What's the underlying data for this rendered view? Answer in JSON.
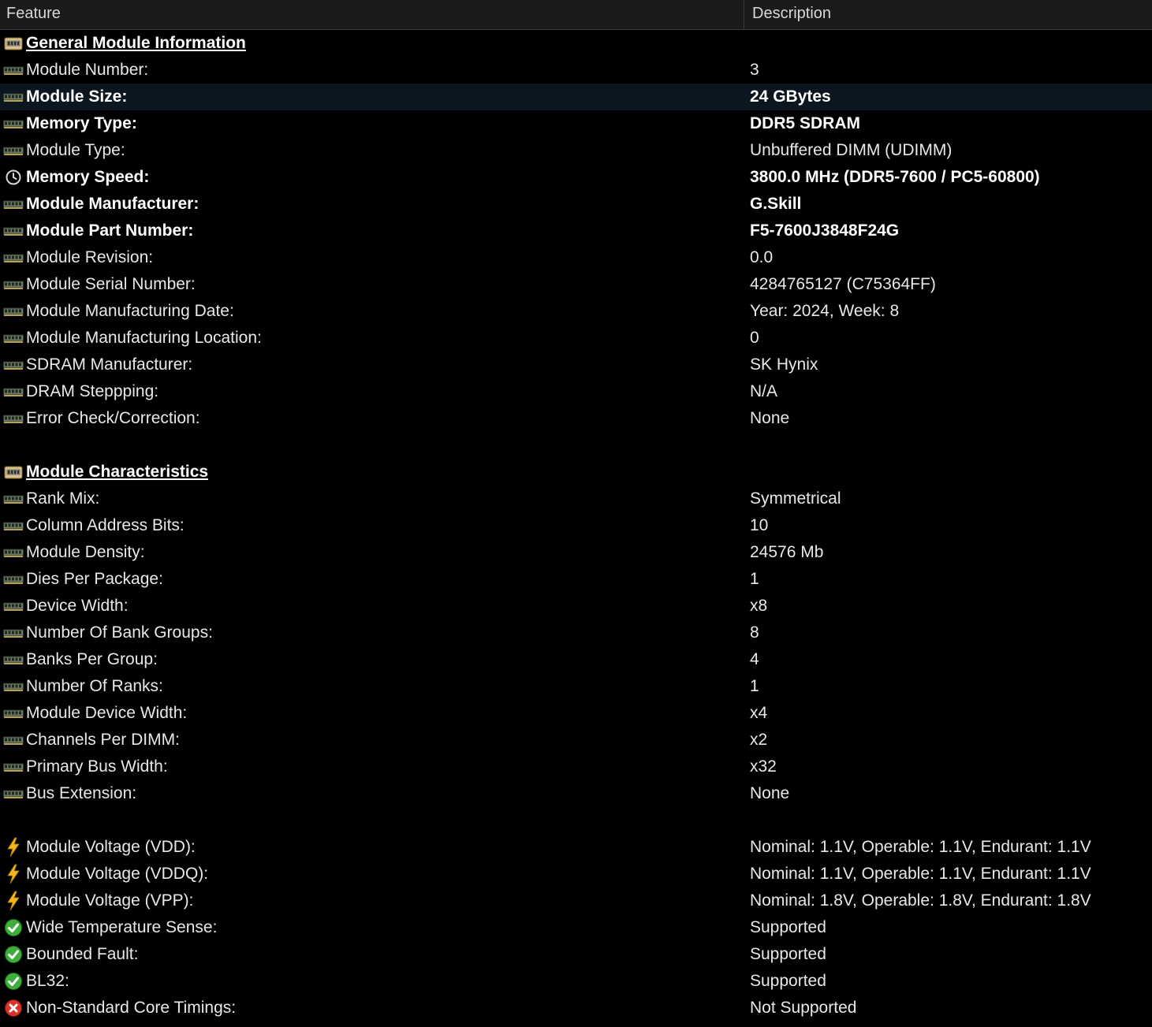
{
  "columns": {
    "feature": "Feature",
    "description": "Description"
  },
  "rows": [
    {
      "type": "section",
      "icon": "module-folder-icon",
      "feature": "General Module Information",
      "desc": ""
    },
    {
      "type": "item",
      "icon": "ram-icon",
      "feature": "Module Number:",
      "desc": "3"
    },
    {
      "type": "item",
      "icon": "ram-icon",
      "feature": "Module Size:",
      "desc": "24 GBytes",
      "bold": true,
      "highlight": true
    },
    {
      "type": "item",
      "icon": "ram-icon",
      "feature": "Memory Type:",
      "desc": "DDR5 SDRAM",
      "bold": true
    },
    {
      "type": "item",
      "icon": "ram-icon",
      "feature": "Module Type:",
      "desc": "Unbuffered DIMM (UDIMM)"
    },
    {
      "type": "item",
      "icon": "clock-icon",
      "feature": "Memory Speed:",
      "desc": "3800.0 MHz (DDR5-7600 / PC5-60800)",
      "bold": true
    },
    {
      "type": "item",
      "icon": "ram-icon",
      "feature": "Module Manufacturer:",
      "desc": "G.Skill",
      "bold": true
    },
    {
      "type": "item",
      "icon": "ram-icon",
      "feature": "Module Part Number:",
      "desc": "F5-7600J3848F24G",
      "bold": true
    },
    {
      "type": "item",
      "icon": "ram-icon",
      "feature": "Module Revision:",
      "desc": "0.0"
    },
    {
      "type": "item",
      "icon": "ram-icon",
      "feature": "Module Serial Number:",
      "desc": "4284765127 (C75364FF)"
    },
    {
      "type": "item",
      "icon": "ram-icon",
      "feature": "Module Manufacturing Date:",
      "desc": "Year: 2024, Week: 8"
    },
    {
      "type": "item",
      "icon": "ram-icon",
      "feature": "Module Manufacturing Location:",
      "desc": "0"
    },
    {
      "type": "item",
      "icon": "ram-icon",
      "feature": "SDRAM Manufacturer:",
      "desc": "SK Hynix"
    },
    {
      "type": "item",
      "icon": "ram-icon",
      "feature": "DRAM Steppping:",
      "desc": "N/A"
    },
    {
      "type": "item",
      "icon": "ram-icon",
      "feature": "Error Check/Correction:",
      "desc": "None"
    },
    {
      "type": "blank"
    },
    {
      "type": "section",
      "icon": "module-folder-icon",
      "feature": "Module Characteristics",
      "desc": ""
    },
    {
      "type": "item",
      "icon": "ram-icon",
      "feature": "Rank Mix:",
      "desc": "Symmetrical"
    },
    {
      "type": "item",
      "icon": "ram-icon",
      "feature": "Column Address Bits:",
      "desc": "10"
    },
    {
      "type": "item",
      "icon": "ram-icon",
      "feature": "Module Density:",
      "desc": "24576 Mb"
    },
    {
      "type": "item",
      "icon": "ram-icon",
      "feature": "Dies Per Package:",
      "desc": "1"
    },
    {
      "type": "item",
      "icon": "ram-icon",
      "feature": "Device Width:",
      "desc": "x8"
    },
    {
      "type": "item",
      "icon": "ram-icon",
      "feature": "Number Of Bank Groups:",
      "desc": "8"
    },
    {
      "type": "item",
      "icon": "ram-icon",
      "feature": "Banks Per Group:",
      "desc": "4"
    },
    {
      "type": "item",
      "icon": "ram-icon",
      "feature": "Number Of Ranks:",
      "desc": "1"
    },
    {
      "type": "item",
      "icon": "ram-icon",
      "feature": "Module Device Width:",
      "desc": "x4"
    },
    {
      "type": "item",
      "icon": "ram-icon",
      "feature": "Channels Per DIMM:",
      "desc": "x2"
    },
    {
      "type": "item",
      "icon": "ram-icon",
      "feature": "Primary Bus Width:",
      "desc": "x32"
    },
    {
      "type": "item",
      "icon": "ram-icon",
      "feature": "Bus Extension:",
      "desc": "None"
    },
    {
      "type": "blank"
    },
    {
      "type": "item",
      "icon": "lightning-icon",
      "feature": "Module Voltage (VDD):",
      "desc": "Nominal: 1.1V, Operable: 1.1V, Endurant: 1.1V"
    },
    {
      "type": "item",
      "icon": "lightning-icon",
      "feature": "Module Voltage (VDDQ):",
      "desc": "Nominal: 1.1V, Operable: 1.1V, Endurant: 1.1V"
    },
    {
      "type": "item",
      "icon": "lightning-icon",
      "feature": "Module Voltage (VPP):",
      "desc": "Nominal: 1.8V, Operable: 1.8V, Endurant: 1.8V"
    },
    {
      "type": "item",
      "icon": "check-icon",
      "feature": "Wide Temperature Sense:",
      "desc": "Supported"
    },
    {
      "type": "item",
      "icon": "check-icon",
      "feature": "Bounded Fault:",
      "desc": "Supported"
    },
    {
      "type": "item",
      "icon": "check-icon",
      "feature": "BL32:",
      "desc": "Supported"
    },
    {
      "type": "item",
      "icon": "error-icon",
      "feature": "Non-Standard Core Timings:",
      "desc": "Not Supported"
    }
  ],
  "colors": {
    "background": "#000000",
    "header": "#1b1b1b",
    "highlight_row": "#0c1620",
    "text": "#e8e8e8"
  }
}
